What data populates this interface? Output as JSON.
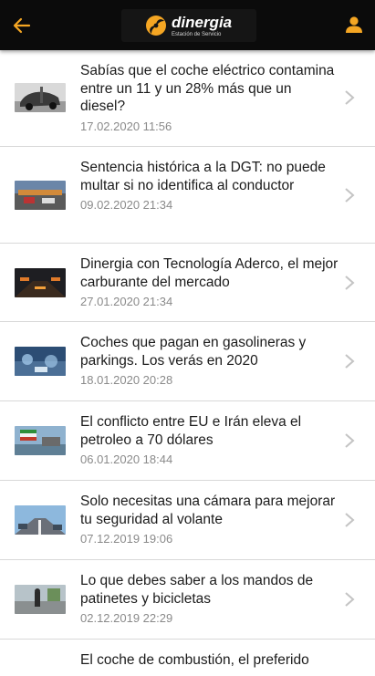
{
  "header": {
    "logo_name": "dinergia",
    "logo_sub": "Estación de Servicio",
    "accent": "#f5a623"
  },
  "articles": [
    {
      "title": "Sabías que el coche eléctrico contamina entre un 11 y un 28% más que un diesel?",
      "date": "17.02.2020 11:56"
    },
    {
      "title": "Sentencia histórica a la DGT: no puede multar si no identifica al conductor",
      "date": "09.02.2020 21:34"
    },
    {
      "title": "Dinergia con Tecnología Aderco, el mejor carburante del mercado",
      "date": "27.01.2020 21:34"
    },
    {
      "title": "Coches que pagan en gasolineras y parkings. Los verás en 2020",
      "date": "18.01.2020 20:28"
    },
    {
      "title": "El conflicto entre EU e Irán eleva el petroleo a 70 dólares",
      "date": "06.01.2020 18:44"
    },
    {
      "title": "Solo necesitas una cámara para mejorar tu seguridad al volante",
      "date": "07.12.2019 19:06"
    },
    {
      "title": "Lo que debes saber a los mandos de patinetes y bicicletas",
      "date": "02.12.2019 22:29"
    },
    {
      "title": "El coche de combustión, el preferido",
      "date": ""
    }
  ]
}
